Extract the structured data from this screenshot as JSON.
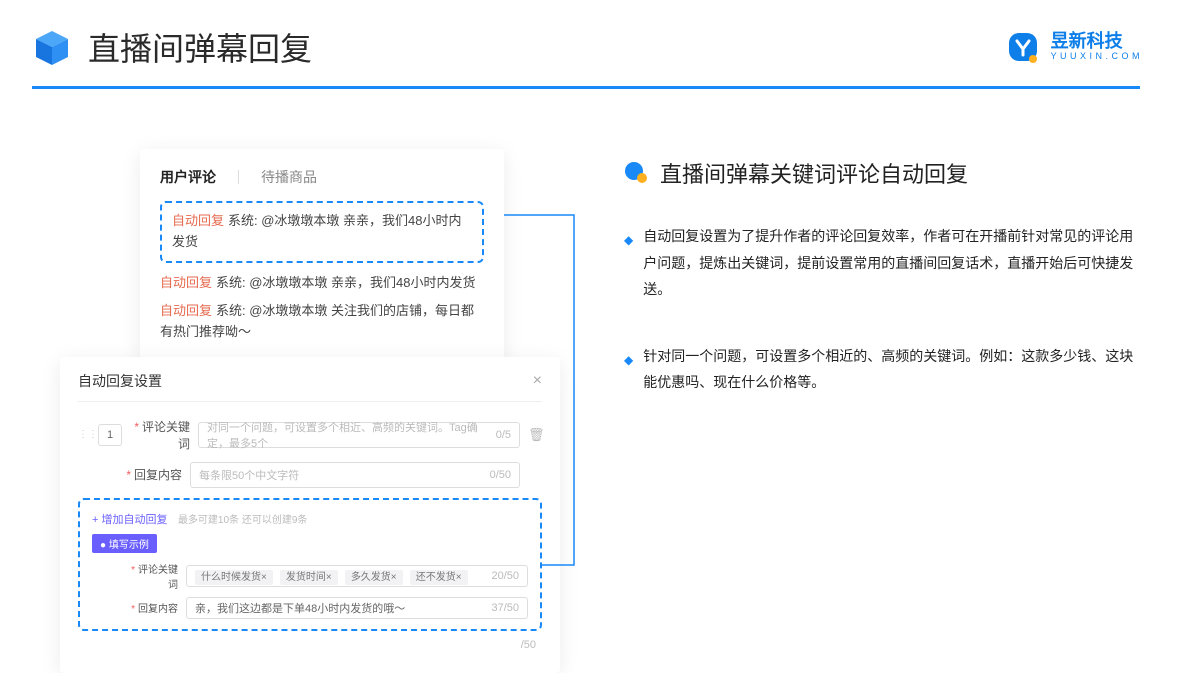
{
  "page": {
    "title": "直播间弹幕回复"
  },
  "brand": {
    "name_cn": "昱新科技",
    "name_en": "Y U U X I N . C O M"
  },
  "comments_panel": {
    "tab_active": "用户评论",
    "tab_other": "待播商品",
    "highlight": {
      "tag": "自动回复",
      "text": "系统: @冰墩墩本墩 亲亲，我们48小时内发货"
    },
    "rows": [
      {
        "tag": "自动回复",
        "text": "系统: @冰墩墩本墩 亲亲，我们48小时内发货"
      },
      {
        "tag": "自动回复",
        "text": "系统: @冰墩墩本墩 关注我们的店铺，每日都有热门推荐呦～"
      }
    ]
  },
  "settings_modal": {
    "title": "自动回复设置",
    "row_num": "1",
    "keyword_label": "评论关键词",
    "keyword_placeholder": "对同一个问题，可设置多个相近、高频的关键词。Tag确定，最多5个",
    "keyword_counter": "0/5",
    "content_label": "回复内容",
    "content_placeholder": "每条限50个中文字符",
    "content_counter": "0/50",
    "add_link": "+ 增加自动回复",
    "add_hint": "最多可建10条 还可以创建9条",
    "example_badge": "● 填写示例",
    "ex_keyword_label": "评论关键词",
    "ex_tags": [
      "什么时候发货×",
      "发货时间×",
      "多久发货×",
      "还不发货×"
    ],
    "ex_keyword_counter": "20/50",
    "ex_content_label": "回复内容",
    "ex_content_value": "亲，我们这边都是下单48小时内发货的哦～",
    "ex_content_counter": "37/50",
    "outer_counter": "/50"
  },
  "right": {
    "heading": "直播间弹幕关键词评论自动回复",
    "bullets": [
      "自动回复设置为了提升作者的评论回复效率，作者可在开播前针对常见的评论用户问题，提炼出关键词，提前设置常用的直播间回复话术，直播开始后可快捷发送。",
      "针对同一个问题，可设置多个相近的、高频的关键词。例如：这款多少钱、这块能优惠吗、现在什么价格等。"
    ]
  }
}
